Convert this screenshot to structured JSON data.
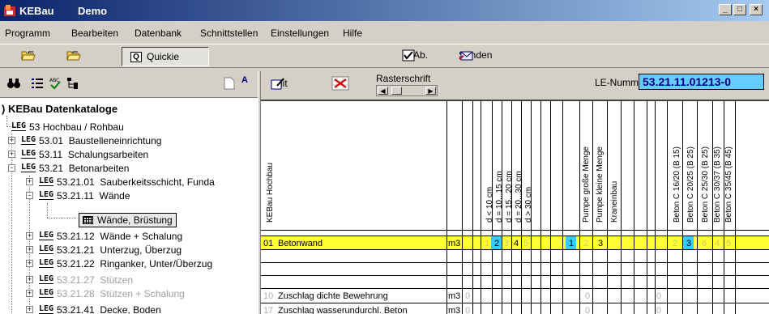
{
  "window": {
    "app_name": "KEBau",
    "document": "Demo",
    "minimize": "_",
    "maximize": "□",
    "close": "×"
  },
  "menu": [
    "Programm",
    "Bearbeiten",
    "Datenbank",
    "Schnittstellen",
    "Einstellungen",
    "Hilfe"
  ],
  "toolbar": {
    "ae": "AE",
    "le": "LE",
    "quickie": "Quickie",
    "m_ab": "M-Ab.",
    "senden": "Senden"
  },
  "left_toolbar": {
    "letters": "A"
  },
  "tree": {
    "root": "KEBau Datenkataloge",
    "items": [
      {
        "code": "53",
        "label": "Hochbau / Rohbau",
        "expander": ""
      },
      {
        "code": "53.01",
        "label": "Baustelleneinrichtung",
        "expander": "+"
      },
      {
        "code": "53.11",
        "label": "Schalungsarbeiten",
        "expander": "+"
      },
      {
        "code": "53.21",
        "label": "Betonarbeiten",
        "expander": "-"
      },
      {
        "code": "53.21.01",
        "label": "Sauberkeitsschicht, Funda",
        "expander": "+"
      },
      {
        "code": "53.21.11",
        "label": "Wände",
        "expander": "-"
      },
      {
        "code": "",
        "label": "Wände, Brüstung",
        "expander": ""
      },
      {
        "code": "53.21.12",
        "label": "Wände + Schalung",
        "expander": "+"
      },
      {
        "code": "53.21.21",
        "label": "Unterzug, Überzug",
        "expander": "+"
      },
      {
        "code": "53.21.22",
        "label": "Ringanker, Unter/Überzug",
        "expander": "+"
      },
      {
        "code": "53.21.27",
        "label": "Stützen",
        "expander": "+"
      },
      {
        "code": "53.21.28",
        "label": "Stützen + Schalung",
        "expander": "+"
      },
      {
        "code": "53.21.41",
        "label": "Decke, Boden",
        "expander": "+"
      }
    ],
    "leg": "LEG"
  },
  "right_toolbar": {
    "edit": "Edit",
    "rasterschrift": "Rasterschrift",
    "le_label": "LE-Nummer:",
    "le_value": "53.21.11.01213-0"
  },
  "grid": {
    "headers": [
      "KEBau Hochbau",
      "d < 10 cm",
      "d = 10...15 cm",
      "d = 15...20 cm",
      "d = 20...30 cm",
      "d > 30 cm",
      "Pumpe große Menge",
      "Pumpe kleine Menge",
      "Kraneinbau",
      "Beton C 16/20 (B 15)",
      "Beton C 20/25 (B 25)",
      "Beton C 25/30 (B 25)",
      "Beton C 30/37 (B 35)",
      "Beton C 35/45 (B 45)"
    ],
    "main_row": {
      "num": "01",
      "text": "Betonwand",
      "unit": "m3",
      "vals": [
        "1",
        "2",
        "3",
        "4",
        "5",
        "1",
        "2",
        "3",
        "2",
        "3",
        "6",
        "4",
        "5"
      ]
    },
    "rows": [
      {
        "num": "10",
        "text": "Zuschlag dichte Bewehrung",
        "unit": "m3",
        "zero": "0"
      },
      {
        "num": "17",
        "text": "Zuschlag wasserundurchl. Beton",
        "unit": "m3",
        "zero": "0"
      }
    ]
  },
  "colors": {
    "highlight_yellow": "#ffff33",
    "selected_cyan": "#33ccff",
    "faint_value": "#cccc66"
  }
}
